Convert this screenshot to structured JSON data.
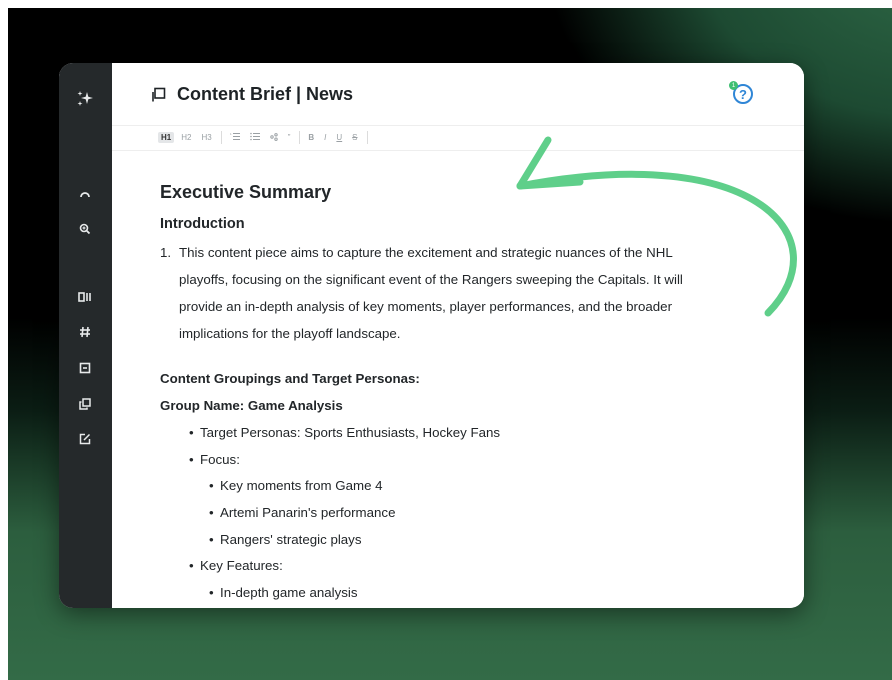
{
  "header": {
    "title": "Content Brief | News",
    "help_label": "?",
    "help_badge": "1"
  },
  "toolbar": {
    "items": [
      "H1",
      "H2",
      "H3",
      "ordered-list-icon",
      "bullet-list-icon",
      "link-icon",
      "quote-icon",
      "B",
      "I",
      "U",
      "S"
    ],
    "h1": "H1",
    "h2": "H2",
    "h3": "H3",
    "quote": "”",
    "bold": "B",
    "italic": "I",
    "underline": "U",
    "strike": "S"
  },
  "sidebar": {
    "icons": [
      "sparkle-icon",
      "gauge-icon",
      "zoom-icon",
      "columns-icon",
      "hash-icon",
      "box-icon",
      "copy-icon",
      "edit-icon"
    ]
  },
  "content": {
    "heading": "Executive Summary",
    "intro_heading": "Introduction",
    "intro_number": "1.",
    "intro_lines": [
      "This content piece aims to capture the excitement and strategic nuances of the NHL",
      "playoffs, focusing on the significant event of the Rangers sweeping the Capitals. It will",
      "provide an in-depth analysis of key moments, player performances, and the broader",
      "implications for the playoff landscape."
    ],
    "groupings_heading": "Content Groupings and Target Personas:",
    "group_name": "Group Name: Game Analysis",
    "bullets": {
      "personas": "Target Personas: Sports Enthusiasts, Hockey Fans",
      "focus": "Focus:",
      "focus_1": "Key moments from Game 4",
      "focus_2": "Artemi Panarin's performance",
      "focus_3": "Rangers' strategic plays",
      "features": "Key Features:",
      "features_1": "In-depth game analysis"
    }
  },
  "colors": {
    "sidebar": "#25292b",
    "accent_green": "#5fcf8a",
    "help_blue": "#2f86d6"
  }
}
